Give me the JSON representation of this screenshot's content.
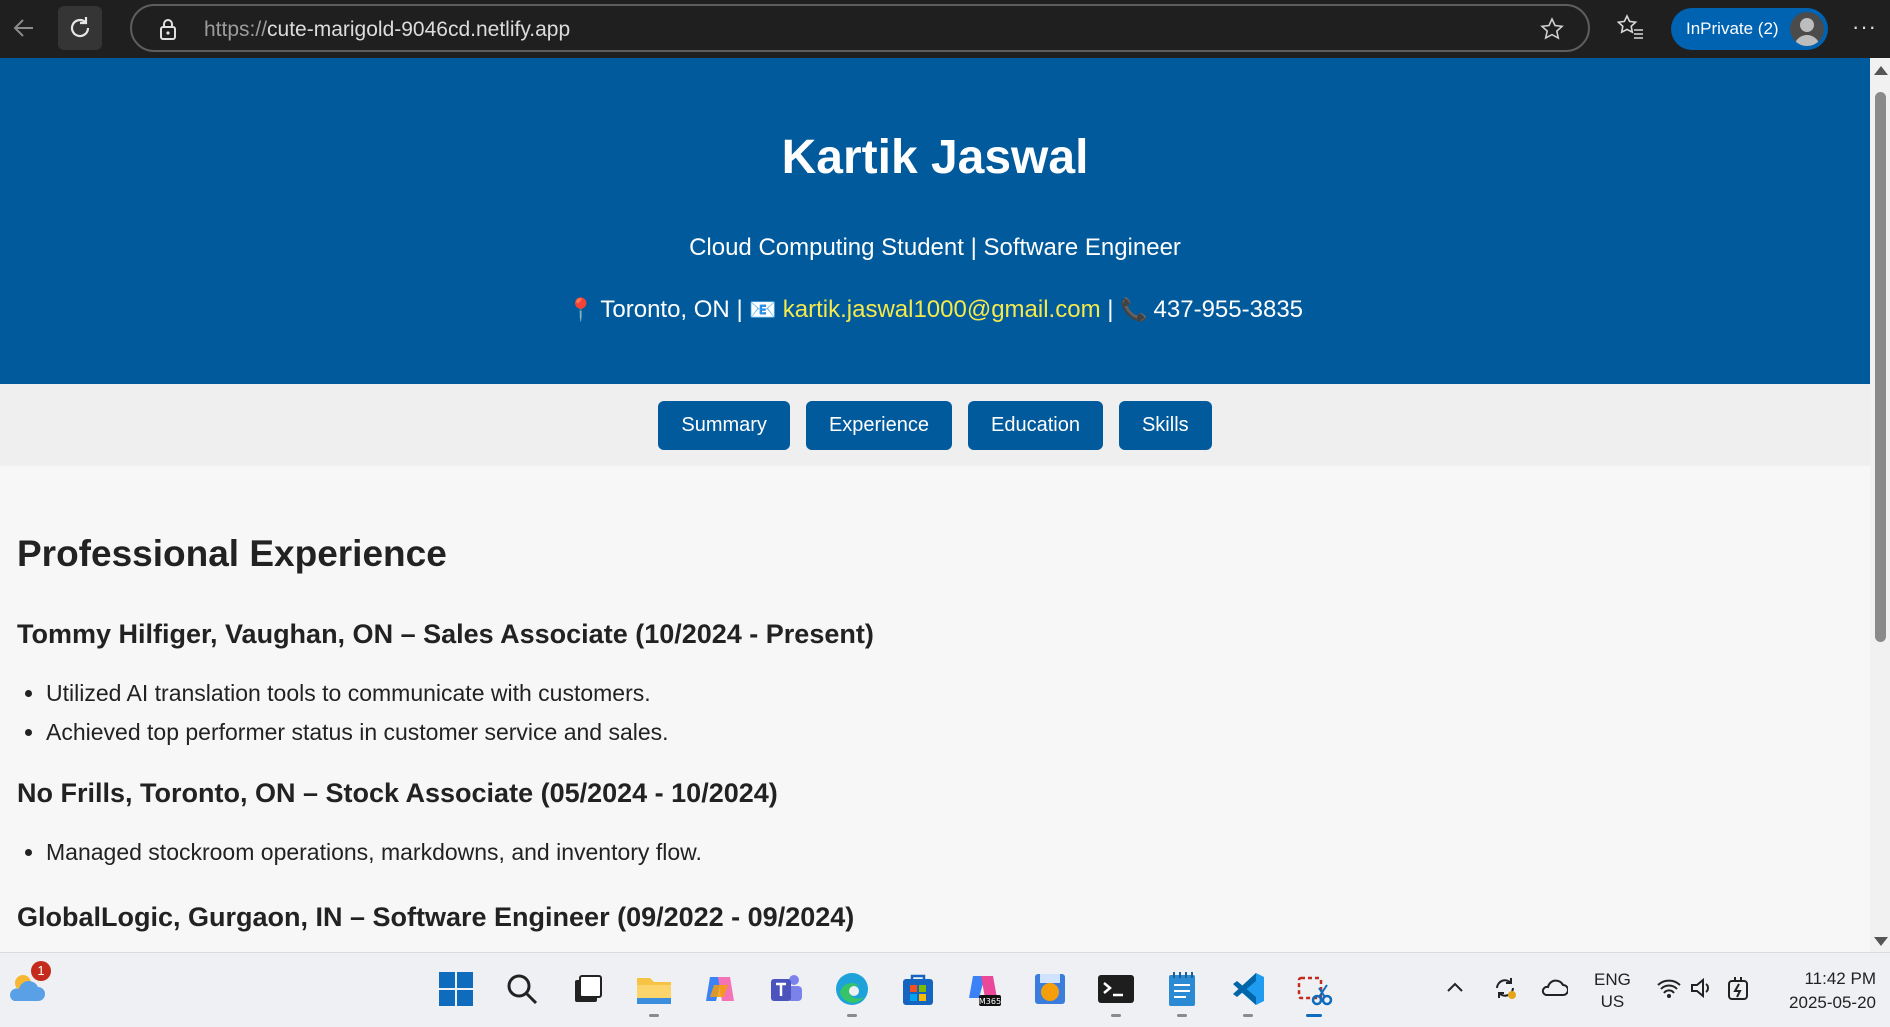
{
  "browser": {
    "url_scheme": "https://",
    "url_host": "cute-marigold-9046cd.netlify.app",
    "inprivate_label": "InPrivate (2)",
    "more_label": "···"
  },
  "header": {
    "name": "Kartik Jaswal",
    "title": "Cloud Computing Student | Software Engineer",
    "location": "Toronto, ON",
    "separator": "|",
    "email": "kartik.jaswal1000@gmail.com",
    "phone": "437-955-3835",
    "background_color": "#005a9c",
    "email_color": "#f5e94b"
  },
  "tabs": [
    {
      "label": "Summary"
    },
    {
      "label": "Experience"
    },
    {
      "label": "Education"
    },
    {
      "label": "Skills"
    }
  ],
  "experience": {
    "heading": "Professional Experience",
    "jobs": [
      {
        "title": "Tommy Hilfiger, Vaughan, ON – Sales Associate (10/2024 - Present)",
        "bullets": [
          "Utilized AI translation tools to communicate with customers.",
          "Achieved top performer status in customer service and sales."
        ]
      },
      {
        "title": "No Frills, Toronto, ON – Stock Associate (05/2024 - 10/2024)",
        "bullets": [
          "Managed stockroom operations, markdowns, and inventory flow."
        ]
      },
      {
        "title": "GlobalLogic, Gurgaon, IN – Software Engineer (09/2022 - 09/2024)"
      }
    ]
  },
  "taskbar": {
    "weather_badge": "1",
    "language": "ENG",
    "region": "US",
    "time": "11:42 PM",
    "date": "2025-05-20"
  }
}
